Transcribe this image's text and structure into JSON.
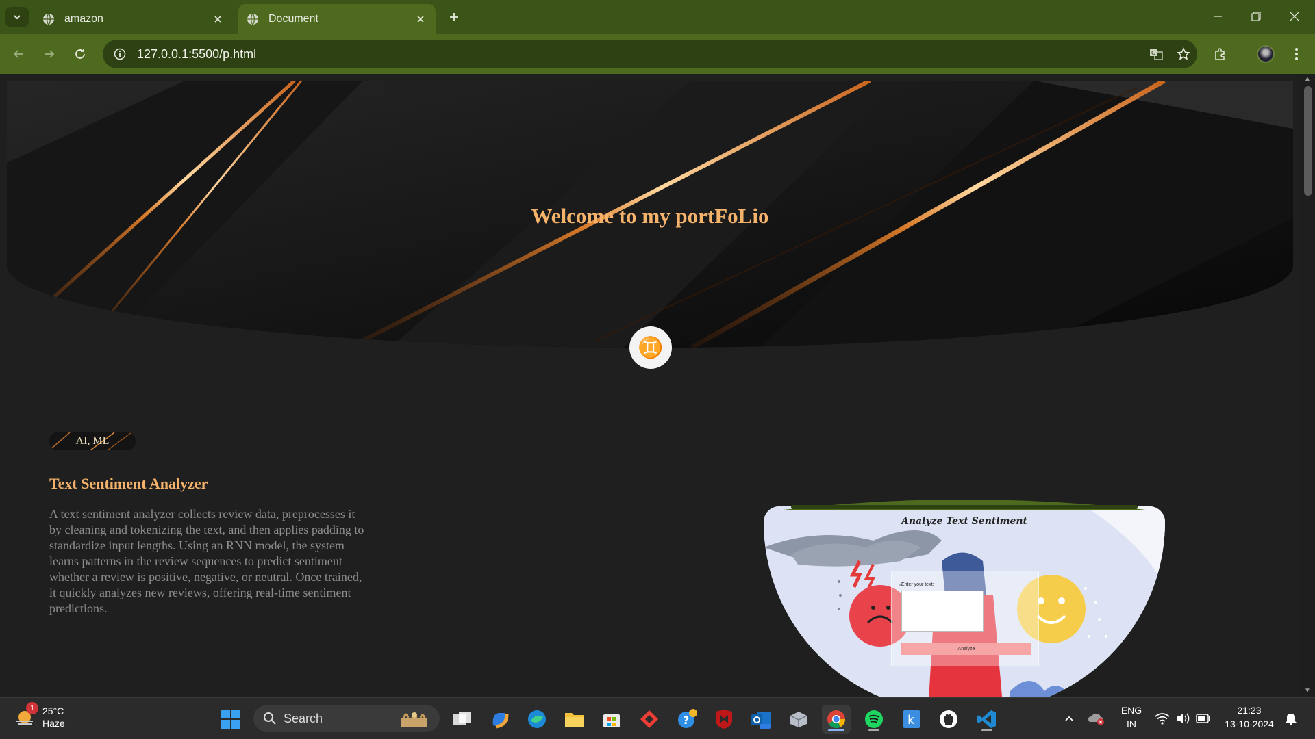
{
  "browser": {
    "tabs": [
      {
        "title": "amazon",
        "active": false
      },
      {
        "title": "Document",
        "active": true
      }
    ],
    "url": "127.0.0.1:5500/p.html"
  },
  "page": {
    "hero_title": "Welcome to my portFoLio",
    "zodiac_symbol": "♊",
    "project": {
      "tag": "AI, ML",
      "title": "Text Sentiment Analyzer",
      "description": "A text sentiment analyzer collects review data, preprocesses it by cleaning and tokenizing the text, and then applies padding to standardize input lengths. Using an RNN model, the system learns patterns in the review sequences to predict sentiment—whether a review is positive, negative, or neutral. Once trained, it quickly analyzes new reviews, offering real-time sentiment predictions.",
      "screenshot": {
        "title": "Analyze Text Sentiment",
        "input_label": "Enter your text:",
        "button_label": "Analyze"
      }
    }
  },
  "taskbar": {
    "weather": {
      "temp": "25°C",
      "condition": "Haze",
      "badge": "1"
    },
    "search_placeholder": "Search",
    "language": {
      "line1": "ENG",
      "line2": "IN"
    },
    "clock": {
      "time": "21:23",
      "date": "13-10-2024"
    }
  },
  "colors": {
    "tabstrip": "#3b5418",
    "toolbar": "#4d6a1f",
    "accent": "#f5b26a",
    "page_bg": "#1f1f1f"
  }
}
